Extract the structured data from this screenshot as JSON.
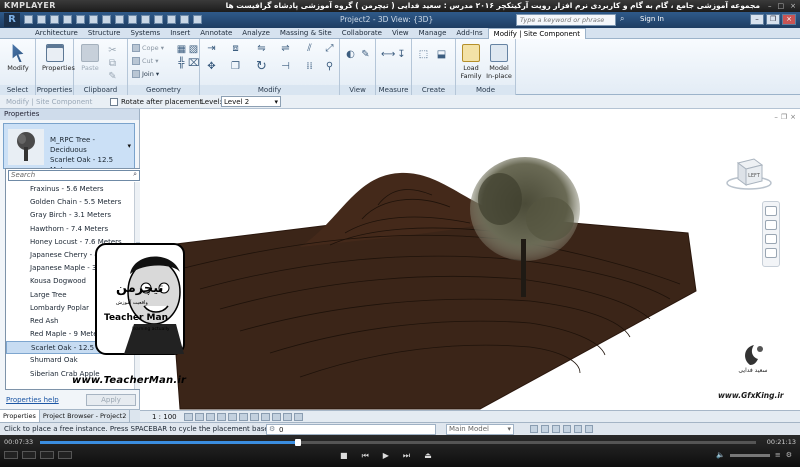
{
  "player": {
    "logo": "KMPLAYER",
    "title": "مجموعه آموزشی جامع ، گام به گام و کاربردی نرم افزار رویت آرکیتکچر ۲۰۱۶ مدرس : سعید فدایی ( تیچرمن ) گروه آموزشی پادشاه گرافیست ها",
    "time_current": "00:07:33",
    "time_total": "00:21:13",
    "progress": 0.36
  },
  "revit": {
    "doc_title": "Project2 - 3D View: {3D}",
    "search_placeholder": "Type a keyword or phrase",
    "sign_in": "Sign In"
  },
  "ribbon_tabs": [
    {
      "label": "Architecture",
      "active": false
    },
    {
      "label": "Structure",
      "active": false
    },
    {
      "label": "Systems",
      "active": false
    },
    {
      "label": "Insert",
      "active": false
    },
    {
      "label": "Annotate",
      "active": false
    },
    {
      "label": "Analyze",
      "active": false
    },
    {
      "label": "Massing & Site",
      "active": false
    },
    {
      "label": "Collaborate",
      "active": false
    },
    {
      "label": "View",
      "active": false
    },
    {
      "label": "Manage",
      "active": false
    },
    {
      "label": "Add-Ins",
      "active": false
    },
    {
      "label": "Modify | Site Component",
      "active": true
    }
  ],
  "ribbon": {
    "select_panel": "Select",
    "modify_button": "Modify",
    "properties_panel": "Properties",
    "properties_button": "Properties",
    "clipboard_panel": "Clipboard",
    "paste_button": "Paste",
    "geometry_panel": "Geometry",
    "cope_label": "Cope",
    "cut_label": "Cut",
    "join_label": "Join",
    "modify_panel": "Modify",
    "view_panel": "View",
    "measure_panel": "Measure",
    "create_panel": "Create",
    "mode_panel": "Mode",
    "load_family_line1": "Load",
    "load_family_line2": "Family",
    "model_inplace_line1": "Model",
    "model_inplace_line2": "In-place"
  },
  "options_bar": {
    "context": "Modify | Site Component",
    "rotate_label": "Rotate after placement",
    "level_label": "Level:",
    "level_value": "Level 2"
  },
  "properties": {
    "header": "Properties",
    "type_line1": "M_RPC Tree - Deciduous",
    "type_line2": "Scarlet Oak - 12.5 Meters",
    "search_placeholder": "Search",
    "items": [
      {
        "label": "Fraxinus - 5.6 Meters",
        "selected": false
      },
      {
        "label": "Golden Chain - 5.5 Meters",
        "selected": false
      },
      {
        "label": "Gray Birch - 3.1 Meters",
        "selected": false
      },
      {
        "label": "Hawthorn - 7.4 Meters",
        "selected": false
      },
      {
        "label": "Honey Locust - 7.6 Meters",
        "selected": false
      },
      {
        "label": "Japanese Cherry - 4.5 Meters",
        "selected": false
      },
      {
        "label": "Japanese Maple - 3.6 Meters",
        "selected": false
      },
      {
        "label": "Kousa Dogwood",
        "selected": false
      },
      {
        "label": "Large Tree",
        "selected": false
      },
      {
        "label": "Lombardy Poplar",
        "selected": false
      },
      {
        "label": "Red Ash",
        "selected": false
      },
      {
        "label": "Red Maple - 9 Meters",
        "selected": false
      },
      {
        "label": "Scarlet Oak - 12.5 Meters",
        "selected": true
      },
      {
        "label": "Shumard Oak",
        "selected": false
      },
      {
        "label": "Siberian Crab Apple",
        "selected": false
      }
    ],
    "help_link": "Properties help",
    "apply_button": "Apply"
  },
  "palette_tabs": [
    {
      "label": "Properties",
      "active": true
    },
    {
      "label": "Project Browser - Project2",
      "active": false
    }
  ],
  "canvas": {
    "viewcube_label": "LEFT",
    "watermark_text": "سعید فدایی",
    "watermark_url": "www.GfxKing.ir"
  },
  "badge": {
    "title_fa": "تیچرمن",
    "subtitle_fa": "واقعیت آموزش",
    "name": "Teacher Man",
    "tagline": "learning actually",
    "url": "www.TeacherMan.ir"
  },
  "view_control": {
    "scale": "1 : 100"
  },
  "status": {
    "text": "Click to place a free instance. Press SPACEBAR to cycle the placement basepoint.",
    "workset_value": "0",
    "model": "Main Model"
  },
  "colors": {
    "terrain": "#3b2518",
    "accent": "#2f5a8a"
  }
}
